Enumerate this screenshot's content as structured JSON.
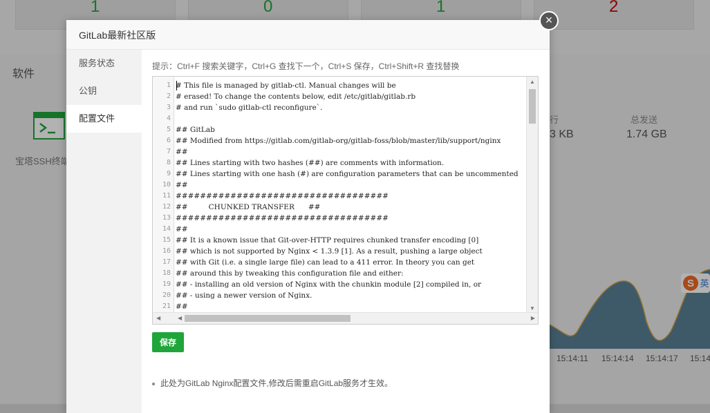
{
  "stats": {
    "values": [
      "1",
      "0",
      "1",
      "2"
    ]
  },
  "software": {
    "title": "软件",
    "terminal_label": "宝塔SSH终端"
  },
  "traffic": {
    "recv_label": "行",
    "recv_value": "3 KB",
    "send_label": "总发送",
    "send_value": "1.74 GB"
  },
  "chart_times": [
    "15:14:11",
    "15:14:14",
    "15:14:17",
    "15:14"
  ],
  "sogou": {
    "text": "英"
  },
  "modal": {
    "title": "GitLab最新社区版",
    "close_glyph": "×",
    "sidebar": [
      {
        "label": "服务状态"
      },
      {
        "label": "公钥"
      },
      {
        "label": "配置文件"
      }
    ],
    "hint": "提示：Ctrl+F 搜索关键字，Ctrl+G 查找下一个，Ctrl+S 保存，Ctrl+Shift+R 查找替换",
    "save_label": "保存",
    "note": "此处为GitLab Nginx配置文件,修改后需重启GitLab服务才生效。"
  },
  "editor": {
    "lines": [
      "# This file is managed by gitlab-ctl. Manual changes will be",
      "# erased! To change the contents below, edit /etc/gitlab/gitlab.rb",
      "# and run `sudo gitlab-ctl reconfigure`.",
      "",
      "## GitLab",
      "## Modified from https://gitlab.com/gitlab-org/gitlab-foss/blob/master/lib/support/nginx",
      "##",
      "## Lines starting with two hashes (##) are comments with information.",
      "## Lines starting with one hash (#) are configuration parameters that can be uncommented",
      "##",
      "###################################",
      "##         CHUNKED TRANSFER      ##",
      "###################################",
      "##",
      "## It is a known issue that Git-over-HTTP requires chunked transfer encoding [0]",
      "## which is not supported by Nginx < 1.3.9 [1]. As a result, pushing a large object",
      "## with Git (i.e. a single large file) can lead to a 411 error. In theory you can get",
      "## around this by tweaking this configuration file and either:",
      "## - installing an old version of Nginx with the chunkin module [2] compiled in, or",
      "## - using a newer version of Nginx.",
      "##"
    ]
  }
}
